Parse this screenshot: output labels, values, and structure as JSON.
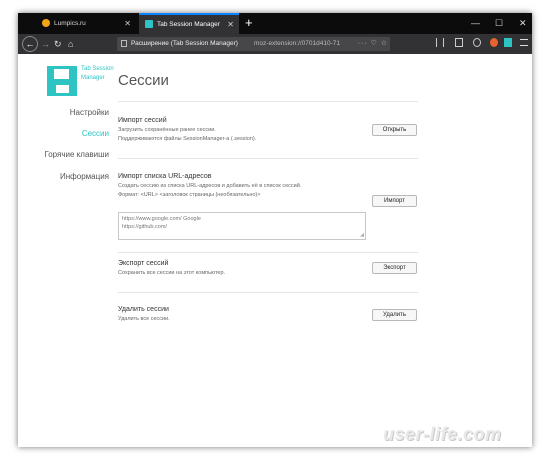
{
  "browser": {
    "tabs": [
      {
        "label": "Lumpics.ru",
        "active": false,
        "favicon_color": "#f3a416"
      },
      {
        "label": "Tab Session Manager",
        "active": true,
        "favicon_color": "#2ec4c4"
      }
    ],
    "new_tab_label": "+",
    "window_controls": {
      "minimize": "—",
      "maximize": "☐",
      "close": "✕"
    },
    "tab_close": "✕",
    "nav_icons": {
      "back": "arrow-left-icon",
      "forward": "arrow-right-icon",
      "reload": "reload-icon",
      "home": "home-icon"
    },
    "nav_glyphs": {
      "back": "←",
      "forward": "→",
      "reload": "↻",
      "home": "⌂"
    },
    "url_prefix": "Расширение (Tab Session Manager)",
    "url": "moz-extension://0701d410-71",
    "url_actions": "··· ♡ ☆",
    "toolbar_icons": [
      "library-icon",
      "sidebar-icon",
      "account-icon",
      "extension-icon",
      "tab-session-manager-icon",
      "menu-icon"
    ]
  },
  "app": {
    "brand_name": "Tab Session Manager",
    "nav": [
      {
        "label": "Настройки",
        "active": false
      },
      {
        "label": "Сессии",
        "active": true
      },
      {
        "label": "Горячие клавиши",
        "active": false
      },
      {
        "label": "Информация",
        "active": false
      }
    ],
    "page_title": "Сессии",
    "sections": {
      "import": {
        "title": "Импорт сессий",
        "desc1": "Загрузить сохранённые ранее сессии.",
        "desc2": "Поддерживаются файлы SessionManager-a (.session).",
        "button": "Открыть"
      },
      "import_url": {
        "title": "Импорт списка URL-адресов",
        "desc1": "Создать сессию из списка URL-адресов и добавить её в список сессий.",
        "desc2": "Формат: <URL> <заголовок страницы (необязательно)>",
        "placeholder_line1": "https://www.google.com/ Google",
        "placeholder_line2": "https://github.com/",
        "button": "Импорт"
      },
      "export": {
        "title": "Экспорт сессий",
        "desc1": "Сохранить все сессии на этот компьютер.",
        "button": "Экспорт"
      },
      "delete": {
        "title": "Удалить сессии",
        "desc1": "Удалить все сессии.",
        "button": "Удалить"
      }
    }
  },
  "watermark": "user-life.com",
  "colors": {
    "accent": "#2ec4c4",
    "tabbar": "#0c0c0d",
    "navbar": "#323234",
    "active_tab_line": "#0a84ff"
  }
}
